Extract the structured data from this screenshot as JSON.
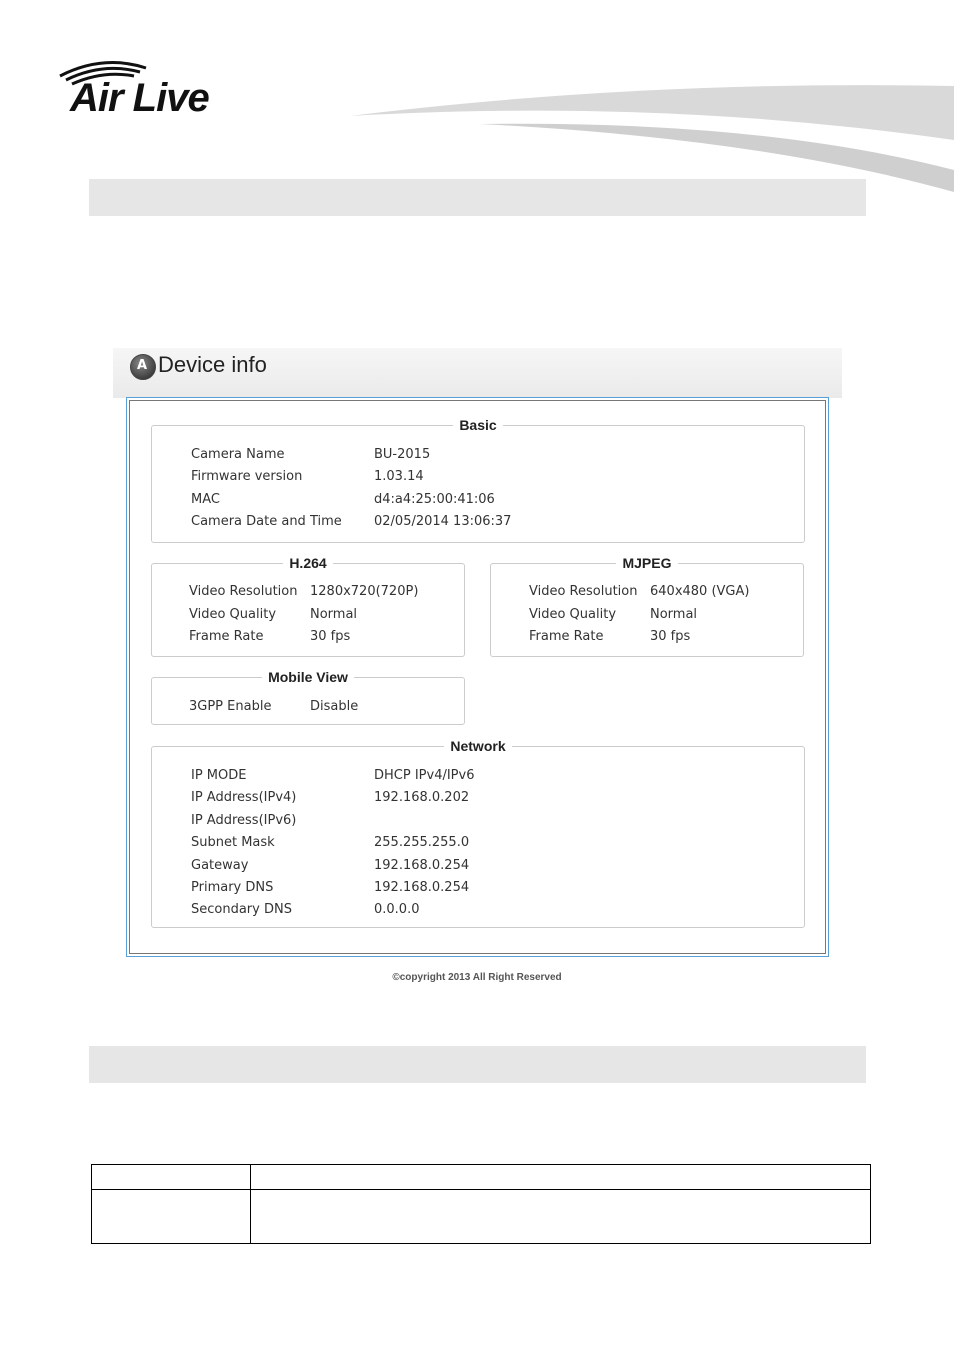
{
  "brand": {
    "logo_text": "Air Live"
  },
  "panel": {
    "title": "Device info",
    "copyright": "©copyright 2013 All Right Reserved"
  },
  "basic": {
    "legend": "Basic",
    "rows": [
      {
        "label": "Camera Name",
        "value": "BU-2015"
      },
      {
        "label": "Firmware version",
        "value": "1.03.14"
      },
      {
        "label": "MAC",
        "value": "d4:a4:25:00:41:06"
      },
      {
        "label": "Camera Date and Time",
        "value": "02/05/2014 13:06:37"
      }
    ]
  },
  "h264": {
    "legend": "H.264",
    "rows": [
      {
        "label": "Video Resolution",
        "value": "1280x720(720P)"
      },
      {
        "label": "Video Quality",
        "value": "Normal"
      },
      {
        "label": "Frame Rate",
        "value": "30 fps"
      }
    ]
  },
  "mjpeg": {
    "legend": "MJPEG",
    "rows": [
      {
        "label": "Video Resolution",
        "value": "640x480 (VGA)"
      },
      {
        "label": "Video Quality",
        "value": "Normal"
      },
      {
        "label": "Frame Rate",
        "value": "30 fps"
      }
    ]
  },
  "mobile": {
    "legend": "Mobile View",
    "rows": [
      {
        "label": "3GPP Enable",
        "value": "Disable"
      }
    ]
  },
  "network": {
    "legend": "Network",
    "rows": [
      {
        "label": "IP MODE",
        "value": "DHCP IPv4/IPv6"
      },
      {
        "label": "IP Address(IPv4)",
        "value": "192.168.0.202"
      },
      {
        "label": "IP Address(IPv6)",
        "value": ""
      },
      {
        "label": "Subnet Mask",
        "value": "255.255.255.0"
      },
      {
        "label": "Gateway",
        "value": "192.168.0.254"
      },
      {
        "label": "Primary DNS",
        "value": "192.168.0.254"
      },
      {
        "label": "Secondary DNS",
        "value": "0.0.0.0"
      }
    ]
  },
  "icons": {
    "panel": "camera-icon"
  }
}
